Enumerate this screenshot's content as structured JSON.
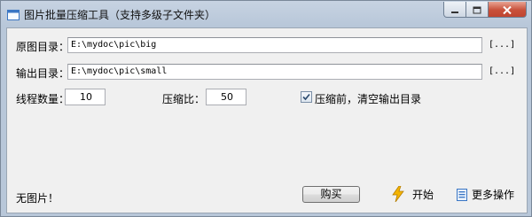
{
  "window": {
    "title": "图片批量压缩工具（支持多级子文件夹）"
  },
  "source": {
    "label": "原图目录：",
    "value": "E:\\mydoc\\pic\\big",
    "browse_label": "[...]"
  },
  "output": {
    "label": "输出目录：",
    "value": "E:\\mydoc\\pic\\small",
    "browse_label": "[...]"
  },
  "threads": {
    "label": "线程数量：",
    "value": "10"
  },
  "ratio": {
    "label": "压缩比：",
    "value": "50"
  },
  "clear_option": {
    "label": "压缩前，清空输出目录",
    "checked": true
  },
  "status": {
    "text": "无图片！"
  },
  "actions": {
    "buy_label": "购买",
    "start_label": "开始",
    "more_label": "更多操作"
  },
  "icons": {
    "app": "app-window-icon",
    "start": "lightning-icon",
    "more": "list-document-icon"
  },
  "colors": {
    "accent": "#3a76c4",
    "close": "#c8503a"
  }
}
